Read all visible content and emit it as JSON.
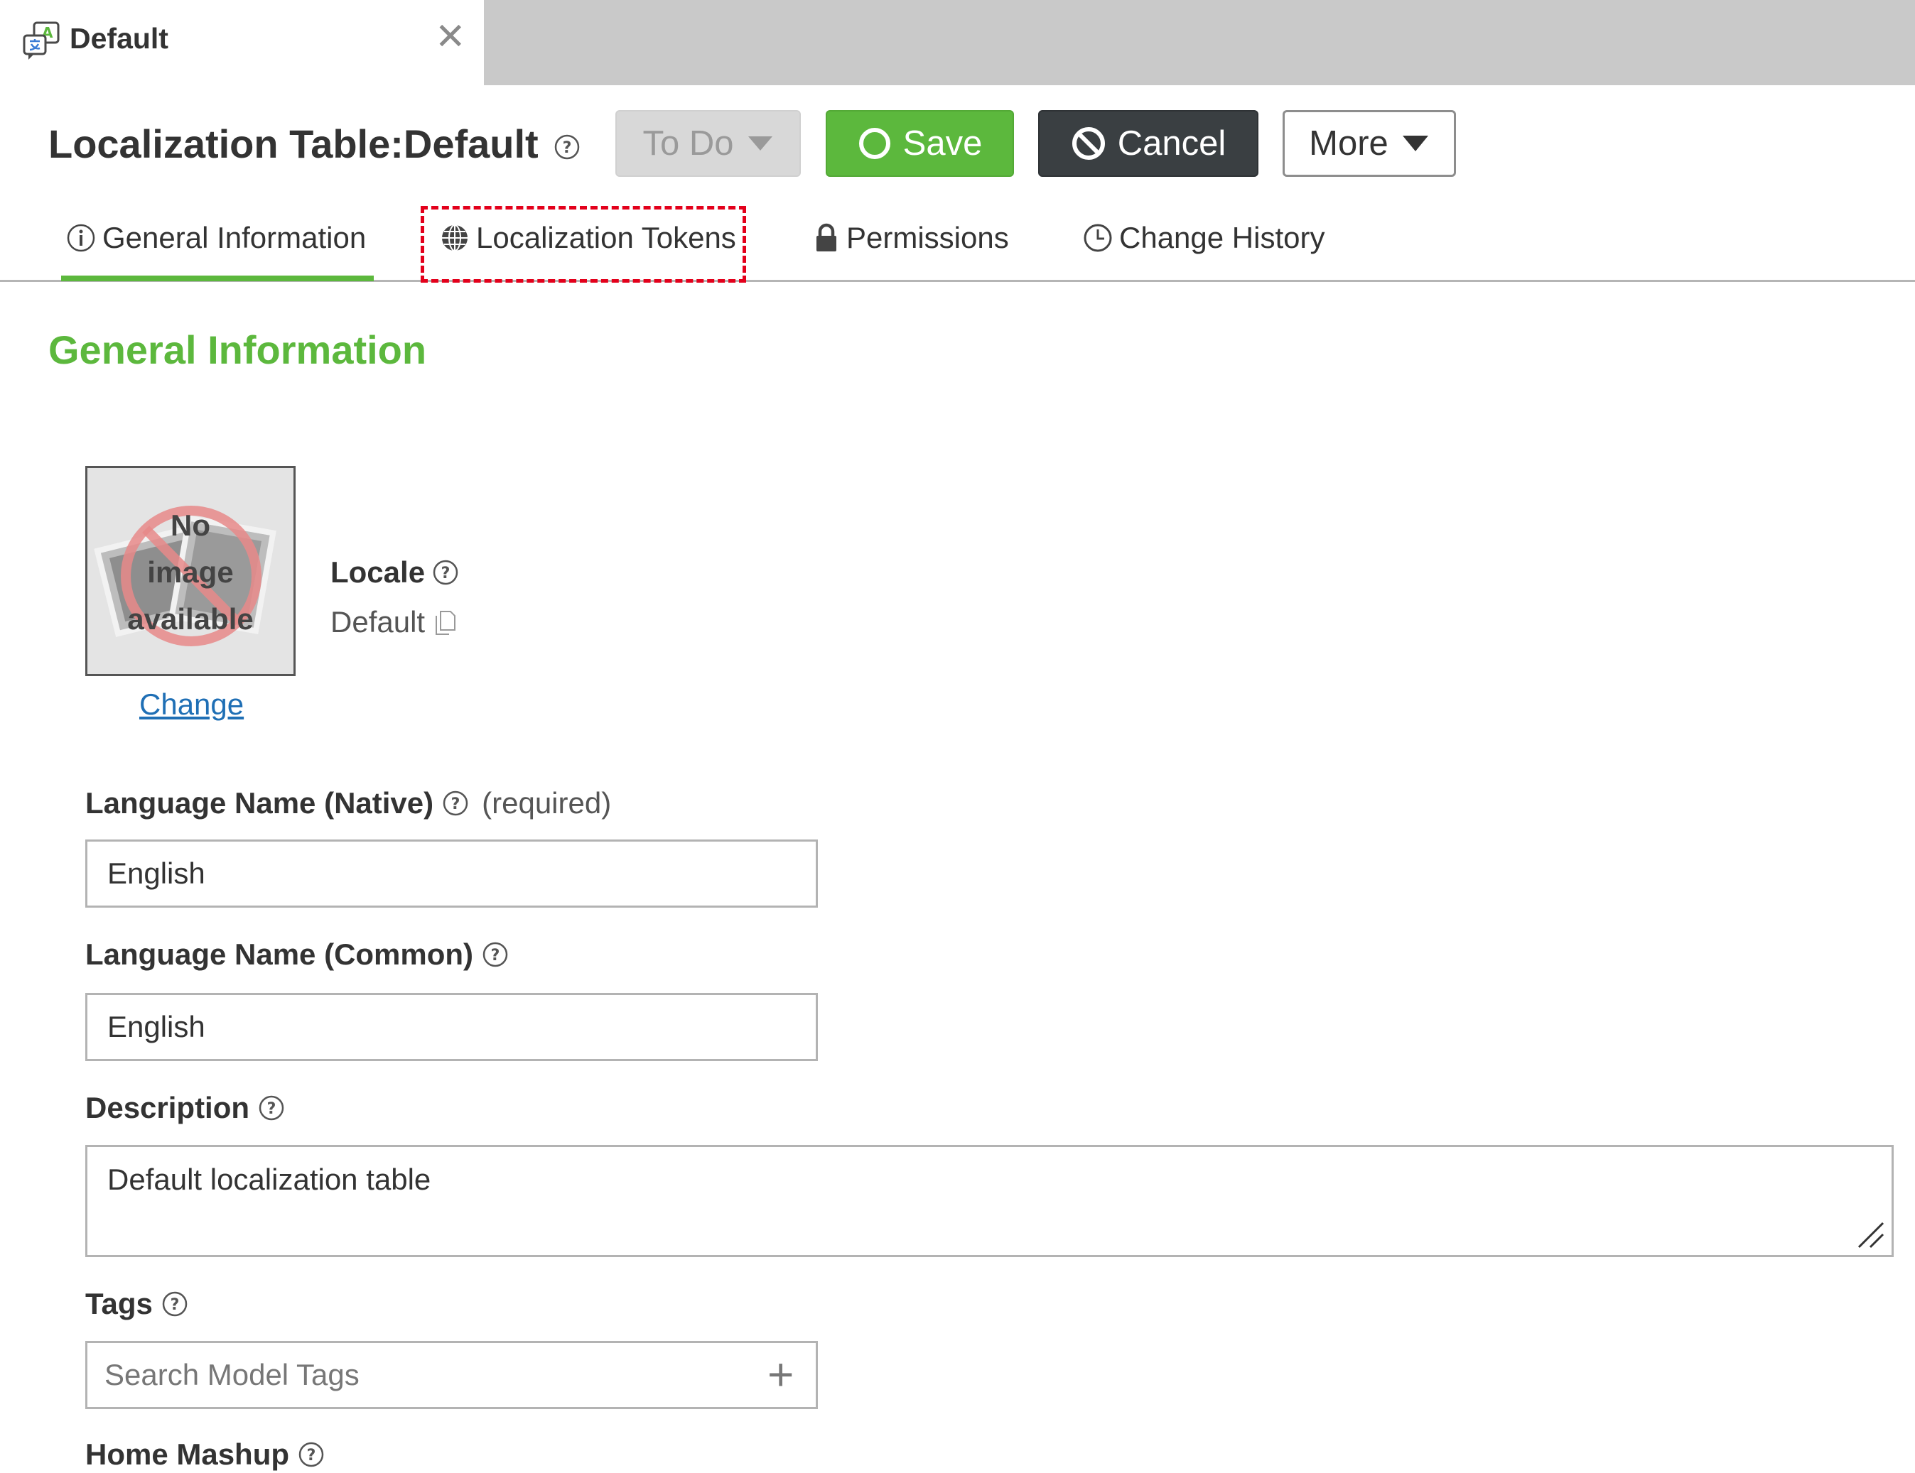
{
  "window_tab": {
    "title": "Default",
    "close_glyph": "✕",
    "icon": "localization-table-icon"
  },
  "header": {
    "title_prefix": "Localization Table:",
    "title_name": "Default",
    "buttons": {
      "todo": "To Do",
      "save": "Save",
      "cancel": "Cancel",
      "more": "More"
    }
  },
  "tabs": [
    {
      "label": "General Information",
      "icon": "info-icon",
      "active": true
    },
    {
      "label": "Localization Tokens",
      "icon": "globe-icon",
      "active": false,
      "highlighted": true
    },
    {
      "label": "Permissions",
      "icon": "lock-icon",
      "active": false
    },
    {
      "label": "Change History",
      "icon": "clock-icon",
      "active": false
    }
  ],
  "section": {
    "heading": "General Information",
    "image": {
      "line1": "No",
      "line2": "image",
      "line3": "available",
      "change_link": "Change"
    },
    "locale": {
      "label": "Locale",
      "value": "Default"
    },
    "fields": {
      "native": {
        "label": "Language Name (Native)",
        "required": "(required)",
        "value": "English"
      },
      "common": {
        "label": "Language Name (Common)",
        "value": "English"
      },
      "description": {
        "label": "Description",
        "value": "Default localization table"
      },
      "tags": {
        "label": "Tags",
        "placeholder": "Search Model Tags",
        "add_glyph": "+"
      },
      "home_mashup": {
        "label": "Home Mashup"
      }
    }
  },
  "colors": {
    "accent_green": "#5cb83d",
    "cancel_dark": "#3a3f42",
    "link_blue": "#1f6fb5",
    "highlight_red": "#e3001b"
  }
}
